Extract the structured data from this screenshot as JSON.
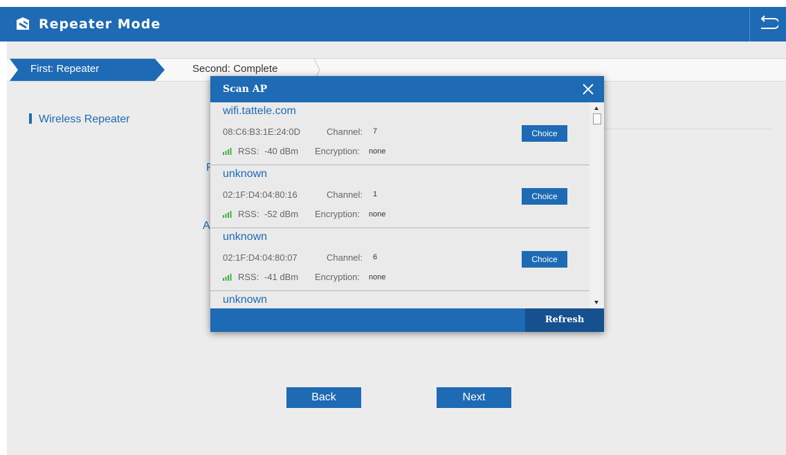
{
  "header": {
    "title": "Repeater Mode",
    "app_icon": "router-icon",
    "back_icon": "return-arrow-icon"
  },
  "steps": [
    {
      "label": "First: Repeater",
      "active": true
    },
    {
      "label": "Second: Complete",
      "active": false
    }
  ],
  "section": {
    "title": "Wireless Repeater"
  },
  "partial_labels": [
    "R",
    "A"
  ],
  "buttons": {
    "back": "Back",
    "next": "Next"
  },
  "modal": {
    "title": "Scan AP",
    "close_icon": "close-icon",
    "refresh_label": "Refresh",
    "channel_label": "Channel:",
    "rss_label": "RSS:",
    "encryption_label": "Encryption:",
    "choice_label": "Choice",
    "access_points": [
      {
        "ssid": "wifi.tattele.com",
        "mac": "08:C6:B3:1E:24:0D",
        "channel": "7",
        "rss": "-40 dBm",
        "encryption": "none"
      },
      {
        "ssid": "unknown",
        "mac": "02:1F:D4:04:80:16",
        "channel": "1",
        "rss": "-52 dBm",
        "encryption": "none"
      },
      {
        "ssid": "unknown",
        "mac": "02:1F:D4:04:80:07",
        "channel": "6",
        "rss": "-41 dBm",
        "encryption": "none"
      },
      {
        "ssid": "unknown"
      }
    ]
  },
  "colors": {
    "primary": "#1e6ab4",
    "footer_dark": "#16508f",
    "signal_green": "#3cb43c",
    "background": "#ececec"
  }
}
